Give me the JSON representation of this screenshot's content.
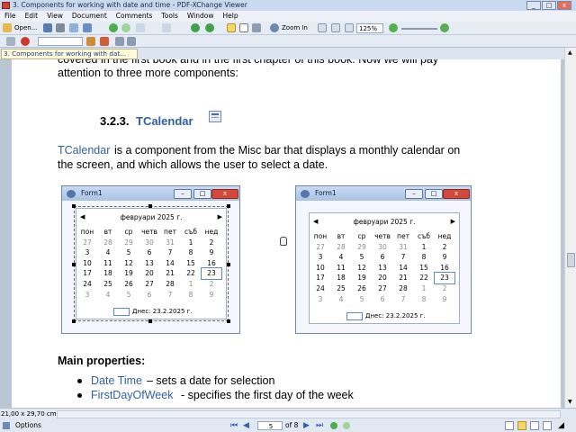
{
  "app": {
    "title": "3. Components for working with date and time - PDF-XChange Viewer"
  },
  "menu": [
    "File",
    "Edit",
    "View",
    "Document",
    "Comments",
    "Tools",
    "Window",
    "Help"
  ],
  "toolbar": {
    "open_label": "Open...",
    "zoom_in_label": "Zoom In",
    "zoom_value": "125%"
  },
  "tab": {
    "label": "3. Components for working with dat..."
  },
  "doc": {
    "line1": "covered in the first book and in the first chapter of this book. Now we will pay",
    "line2": "attention to three more components:",
    "heading_num": "3.2.3.",
    "heading_name": "TCalendar",
    "para_name": "TCalendar",
    "para_rest1": " is a component from the Misc bar that displays a monthly calendar on",
    "para_line2": "the screen, and which allows the user to select a date.",
    "main_props": "Main properties:",
    "b1_name": "Date Time",
    "b1_rest": " – sets a date for selection",
    "b2_name": "FirstDayOfWeek",
    "b2_rest": " - specifies the first day of the week"
  },
  "form": {
    "title": "Form1",
    "month": "февруари 2025 г.",
    "days": [
      "пон",
      "вт",
      "ср",
      "четв",
      "пет",
      "съб",
      "нед"
    ],
    "weeks": [
      [
        [
          "27",
          1
        ],
        [
          "28",
          1
        ],
        [
          "29",
          1
        ],
        [
          "30",
          1
        ],
        [
          "31",
          1
        ],
        [
          "1",
          0
        ],
        [
          "2",
          0
        ]
      ],
      [
        [
          "3",
          0
        ],
        [
          "4",
          0
        ],
        [
          "5",
          0
        ],
        [
          "6",
          0
        ],
        [
          "7",
          0
        ],
        [
          "8",
          0
        ],
        [
          "9",
          0
        ]
      ],
      [
        [
          "10",
          0
        ],
        [
          "11",
          0
        ],
        [
          "12",
          0
        ],
        [
          "13",
          0
        ],
        [
          "14",
          0
        ],
        [
          "15",
          0
        ],
        [
          "16",
          0
        ]
      ],
      [
        [
          "17",
          0
        ],
        [
          "18",
          0
        ],
        [
          "19",
          0
        ],
        [
          "20",
          0
        ],
        [
          "21",
          0
        ],
        [
          "22",
          0
        ],
        [
          "23",
          0
        ]
      ],
      [
        [
          "24",
          0
        ],
        [
          "25",
          0
        ],
        [
          "26",
          0
        ],
        [
          "27",
          0
        ],
        [
          "28",
          0
        ],
        [
          "1",
          1
        ],
        [
          "2",
          1
        ]
      ],
      [
        [
          "3",
          1
        ],
        [
          "4",
          1
        ],
        [
          "5",
          1
        ],
        [
          "6",
          1
        ],
        [
          "7",
          1
        ],
        [
          "8",
          1
        ],
        [
          "9",
          1
        ]
      ]
    ],
    "today_label": "Днес: 23.2.2025 г."
  },
  "status": {
    "page_size": "21,00 x 29,70 cm"
  },
  "nav": {
    "options_label": "Options",
    "page_current": "5",
    "page_total": "of 8"
  },
  "colors": {
    "link": "#2f5fa5",
    "close": "#d2483b"
  }
}
